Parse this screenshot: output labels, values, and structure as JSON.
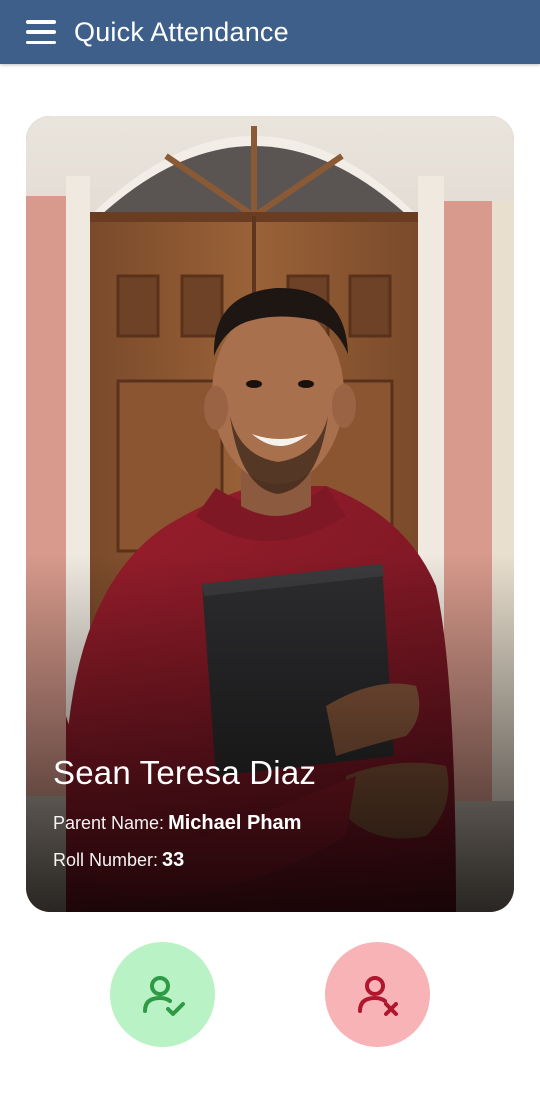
{
  "header": {
    "title": "Quick Attendance",
    "menu_icon": "hamburger-menu-icon",
    "background": "#3d5f8a"
  },
  "student": {
    "name": "Sean Teresa Diaz",
    "parent_label": "Parent Name:",
    "parent_name": "Michael Pham",
    "roll_label": "Roll Number:",
    "roll_number": "33"
  },
  "actions": {
    "present_icon": "user-check-icon",
    "absent_icon": "user-x-icon",
    "present_bg": "#b9f2c4",
    "present_fg": "#2e9a45",
    "absent_bg": "#f8b3b7",
    "absent_fg": "#b0162e"
  }
}
